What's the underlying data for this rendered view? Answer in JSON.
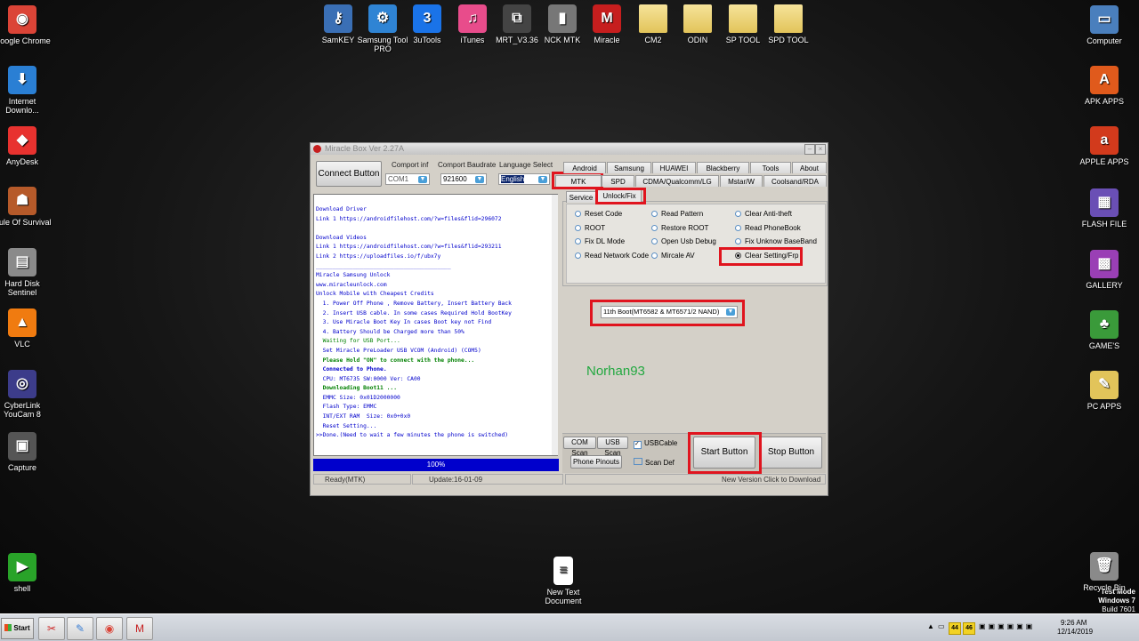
{
  "desktop": {
    "left_icons": [
      {
        "label": "Google Chrome",
        "glyph": "◉",
        "color": "#db4437"
      },
      {
        "label": "Internet Downlo...",
        "glyph": "⬇",
        "color": "#2a7fd4"
      },
      {
        "label": "AnyDesk",
        "glyph": "◆",
        "color": "#e8322f"
      },
      {
        "label": "Rule Of Survival",
        "glyph": "☗",
        "color": "#b65a2a"
      },
      {
        "label": "Hard Disk Sentinel",
        "glyph": "▤",
        "color": "#8a8a8a"
      },
      {
        "label": "VLC",
        "glyph": "▲",
        "color": "#f07b10"
      },
      {
        "label": "CyberLink YouCam 8",
        "glyph": "◎",
        "color": "#3c3c8a"
      },
      {
        "label": "Capture",
        "glyph": "▣",
        "color": "#555555"
      },
      {
        "label": "shell",
        "glyph": "▶",
        "color": "#29a329"
      }
    ],
    "top_icons": [
      {
        "label": "SamKEY",
        "glyph": "⚷",
        "color": "#3a6fb5",
        "folder": false
      },
      {
        "label": "Samsung Tool PRO",
        "glyph": "⚙",
        "color": "#2f84d4",
        "folder": false
      },
      {
        "label": "3uTools",
        "glyph": "3",
        "color": "#1a73e8",
        "folder": false
      },
      {
        "label": "iTunes",
        "glyph": "♫",
        "color": "#e84c8b",
        "folder": false
      },
      {
        "label": "MRT_V3.36",
        "glyph": "⧉",
        "color": "#444444",
        "folder": false
      },
      {
        "label": "NCK MTK",
        "glyph": "▮",
        "color": "#777777",
        "folder": false
      },
      {
        "label": "Miracle",
        "glyph": "M",
        "color": "#c61e1e",
        "folder": false
      },
      {
        "label": "CM2",
        "glyph": "",
        "color": "#e2c45a",
        "folder": true
      },
      {
        "label": "ODIN",
        "glyph": "",
        "color": "#e2c45a",
        "folder": true
      },
      {
        "label": "SP TOOL",
        "glyph": "",
        "color": "#e2c45a",
        "folder": true
      },
      {
        "label": "SPD TOOL",
        "glyph": "",
        "color": "#e2c45a",
        "folder": true
      }
    ],
    "right_icons": [
      {
        "label": "Computer",
        "glyph": "▭",
        "color": "#4a7fbd"
      },
      {
        "label": "APK APPS",
        "glyph": "A",
        "color": "#e05a1c"
      },
      {
        "label": "APPLE APPS",
        "glyph": "a",
        "color": "#d23a1c"
      },
      {
        "label": "FLASH FILE",
        "glyph": "▦",
        "color": "#6a4fb5"
      },
      {
        "label": "GALLERY",
        "glyph": "▩",
        "color": "#9a3fb5"
      },
      {
        "label": "GAME'S",
        "glyph": "♣",
        "color": "#3a9a3a"
      },
      {
        "label": "PC APPS",
        "glyph": "✎",
        "color": "#e2c45a"
      },
      {
        "label": "Recycle Bin",
        "glyph": "🗑",
        "color": "#8a8a8a"
      }
    ],
    "new_doc": "New Text Document",
    "watermark": [
      "Test Mode",
      "Windows 7",
      "Build 7601"
    ]
  },
  "window": {
    "title": "Miracle Box Ver 2.27A",
    "connect_button": "Connect Button",
    "comport_label": "Comport inf",
    "comport_value": "COM1",
    "baud_label": "Comport Baudrate",
    "baud_value": "921600",
    "lang_label": "Language Select",
    "lang_value": "English",
    "tabs_row1": [
      "Android",
      "Samsung",
      "HUAWEI",
      "Blackberry",
      "Tools",
      "About"
    ],
    "tabs_row2": [
      "MTK",
      "SPD",
      "CDMA/Qualcomm/LG",
      "Mstar/W",
      "Coolsand/RDA"
    ],
    "subtabs": [
      "Service",
      "Unlock/Fix"
    ],
    "options": [
      [
        "Reset Code",
        "Read Pattern",
        "Clear Anti-theft"
      ],
      [
        "ROOT",
        "Restore ROOT",
        "Read PhoneBook"
      ],
      [
        "Fix DL Mode",
        "Open Usb Debug",
        "Fix Unknow BaseBand"
      ],
      [
        "Read Network Code",
        "Mircale AV",
        "Clear Setting/Frp"
      ]
    ],
    "boot_select": "11th Boot(MT6582 & MT6571/2 NAND)",
    "watermark_name": "Norhan93",
    "com_scan": "COM Scan",
    "usb_scan": "USB Scan",
    "usb_cable": "USBCable",
    "phone_pinouts": "Phone Pinouts",
    "scan_def": "Scan Def",
    "start_button": "Start Button",
    "stop_button": "Stop Button",
    "progress": "100%",
    "status_left": "Ready(MTK)",
    "status_mid": "Update:16-01-09",
    "status_right": "New Version Click to Download",
    "log": [
      {
        "t": "Download Driver",
        "c": "c-blue"
      },
      {
        "t": "Link 1 https://androidfilehost.com/?w=files&flid=296072",
        "c": "c-blue"
      },
      {
        "t": "",
        "c": ""
      },
      {
        "t": "Download Videos",
        "c": "c-blue"
      },
      {
        "t": "Link 1 https://androidfilehost.com/?w=files&flid=293211",
        "c": "c-blue"
      },
      {
        "t": "Link 2 https://uploadfiles.io/f/ubx7y",
        "c": "c-blue"
      },
      {
        "t": "________________________________________",
        "c": "c-blue"
      },
      {
        "t": "Miracle Samsung Unlock",
        "c": "c-blue"
      },
      {
        "t": "www.miracleunlock.com",
        "c": "c-blue"
      },
      {
        "t": "Unlock Mobile with Cheapest Credits",
        "c": "c-blue"
      },
      {
        "t": "  1. Power Off Phone , Remove Battery, Insert Battery Back",
        "c": "c-blue"
      },
      {
        "t": "  2. Insert USB cable. In some cases Required Hold BootKey",
        "c": "c-blue"
      },
      {
        "t": "  3. Use Miracle Boot Key In cases Boot key not Find",
        "c": "c-blue"
      },
      {
        "t": "  4. Battery Should be Charged more than 50%",
        "c": "c-blue"
      },
      {
        "t": "  Waiting for USB Port...",
        "c": "c-green"
      },
      {
        "t": "  Set Miracle PreLoader USB VCOM (Android) (COM5)",
        "c": "c-blue"
      },
      {
        "t": "  Please Hold \"ON\" to connect with the phone...",
        "c": "c-green c-bold"
      },
      {
        "t": "  Connected to Phone.",
        "c": "c-blue c-bold"
      },
      {
        "t": "  CPU: MT6735 SW:0000 Ver: CA00",
        "c": "c-blue"
      },
      {
        "t": "  Downloading Boot11 ...",
        "c": "c-green c-bold"
      },
      {
        "t": "  EMMC Size: 0x01D2000000",
        "c": "c-blue"
      },
      {
        "t": "  Flash Type: EMMC",
        "c": "c-blue"
      },
      {
        "t": "  INT/EXT RAM  Size: 0x0+0x0",
        "c": "c-blue"
      },
      {
        "t": "  Reset Setting...",
        "c": "c-blue"
      },
      {
        "t": ">>Done.(Need to wait a few minutes the phone is switched)",
        "c": "c-blue"
      }
    ]
  },
  "taskbar": {
    "start": "Start",
    "apps": [
      "✂",
      "✎",
      "◉",
      "M"
    ],
    "tray_badges": [
      "44",
      "46"
    ],
    "time": "9:26 AM",
    "date": "12/14/2019"
  }
}
